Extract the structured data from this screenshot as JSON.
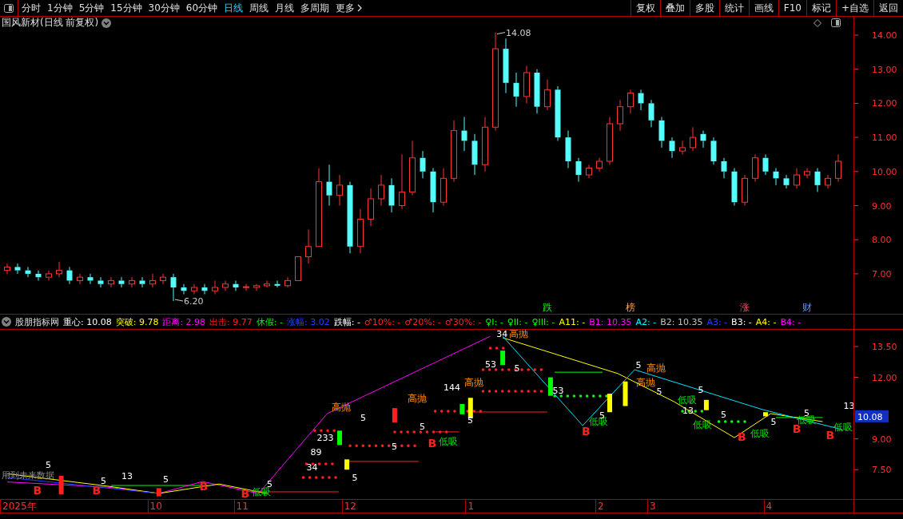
{
  "toolbar": {
    "periods": [
      {
        "label": "分时",
        "selected": false
      },
      {
        "label": "1分钟",
        "selected": false
      },
      {
        "label": "5分钟",
        "selected": false
      },
      {
        "label": "15分钟",
        "selected": false
      },
      {
        "label": "30分钟",
        "selected": false
      },
      {
        "label": "60分钟",
        "selected": false
      },
      {
        "label": "日线",
        "selected": true
      },
      {
        "label": "周线",
        "selected": false
      },
      {
        "label": "月线",
        "selected": false
      },
      {
        "label": "多周期",
        "selected": false
      }
    ],
    "more": "更多",
    "buttons": [
      "复权",
      "叠加",
      "多股",
      "统计",
      "画线",
      "F10",
      "标记",
      "+自选",
      "返回"
    ]
  },
  "main": {
    "title": "国风新材(日线 前复权)",
    "yticks": [
      "14.00",
      "13.00",
      "12.00",
      "11.00",
      "10.00",
      "9.00",
      "8.00",
      "7.00"
    ],
    "annotations": [
      "14.08",
      "6.20"
    ],
    "markers": [
      "跌",
      "榜",
      "涨",
      "财"
    ]
  },
  "indicator": {
    "title": "股朋指标网",
    "items": [
      "重心: 10.08",
      "突破: 9.78",
      "距离: 2.98",
      "出击: 9.77",
      "休假: -",
      "涨幅: 3.02",
      "跌幅: -",
      "♂10%: -",
      "♂20%: -",
      "♂30%: -",
      "♀I: -",
      "♀II: -",
      "♀III: -",
      "A11: -",
      "B1: 10.35",
      "A2: -",
      "B2: 10.35",
      "A3: -",
      "B3: -",
      "A4: -",
      "B4: -"
    ],
    "yticks": [
      "13.50",
      "12.00",
      "9.00",
      "7.50"
    ],
    "current": "10.08",
    "signals": [
      {
        "kind": "sell",
        "text": "高抛"
      },
      {
        "kind": "sell",
        "text": "高抛"
      },
      {
        "kind": "sell",
        "text": "高抛"
      },
      {
        "kind": "sell",
        "text": "高抛"
      },
      {
        "kind": "sell",
        "text": "高抛"
      },
      {
        "kind": "sell",
        "text": "高抛"
      },
      {
        "kind": "buy",
        "text": "低吸"
      },
      {
        "kind": "buy",
        "text": "低吸"
      },
      {
        "kind": "buy",
        "text": "低吸"
      },
      {
        "kind": "buy",
        "text": "低吸"
      },
      {
        "kind": "buy",
        "text": "低吸"
      },
      {
        "kind": "buy",
        "text": "低吸"
      },
      {
        "kind": "buy",
        "text": "低吸"
      },
      {
        "kind": "buy",
        "text": "低吸"
      },
      {
        "kind": "b",
        "text": "B"
      },
      {
        "kind": "b",
        "text": "B"
      },
      {
        "kind": "b",
        "text": "B"
      },
      {
        "kind": "b",
        "text": "B"
      },
      {
        "kind": "b",
        "text": "B"
      },
      {
        "kind": "b",
        "text": "B"
      },
      {
        "kind": "b",
        "text": "B"
      },
      {
        "kind": "b",
        "text": "B"
      },
      {
        "kind": "b",
        "text": "B"
      },
      {
        "kind": "count",
        "text": "5"
      },
      {
        "kind": "count",
        "text": "5"
      },
      {
        "kind": "count",
        "text": "5"
      },
      {
        "kind": "count",
        "text": "5"
      },
      {
        "kind": "count",
        "text": "5"
      },
      {
        "kind": "count",
        "text": "5"
      },
      {
        "kind": "count",
        "text": "5"
      },
      {
        "kind": "count",
        "text": "5"
      },
      {
        "kind": "count",
        "text": "5"
      },
      {
        "kind": "count",
        "text": "5"
      },
      {
        "kind": "count",
        "text": "5"
      },
      {
        "kind": "count",
        "text": "5"
      },
      {
        "kind": "count",
        "text": "5"
      },
      {
        "kind": "count",
        "text": "5"
      },
      {
        "kind": "count",
        "text": "5"
      },
      {
        "kind": "count",
        "text": "5"
      },
      {
        "kind": "count",
        "text": "5"
      },
      {
        "kind": "count",
        "text": "233"
      },
      {
        "kind": "count",
        "text": "89"
      },
      {
        "kind": "count",
        "text": "34"
      },
      {
        "kind": "count",
        "text": "144"
      },
      {
        "kind": "count",
        "text": "53"
      },
      {
        "kind": "count",
        "text": "34"
      },
      {
        "kind": "count",
        "text": "53"
      },
      {
        "kind": "count",
        "text": "13"
      },
      {
        "kind": "count",
        "text": "13"
      },
      {
        "kind": "count",
        "text": "13"
      }
    ],
    "note": "用到未来数据"
  },
  "time_axis": [
    "2025年",
    "10",
    "11",
    "12",
    "1",
    "2",
    "3",
    "4"
  ]
}
